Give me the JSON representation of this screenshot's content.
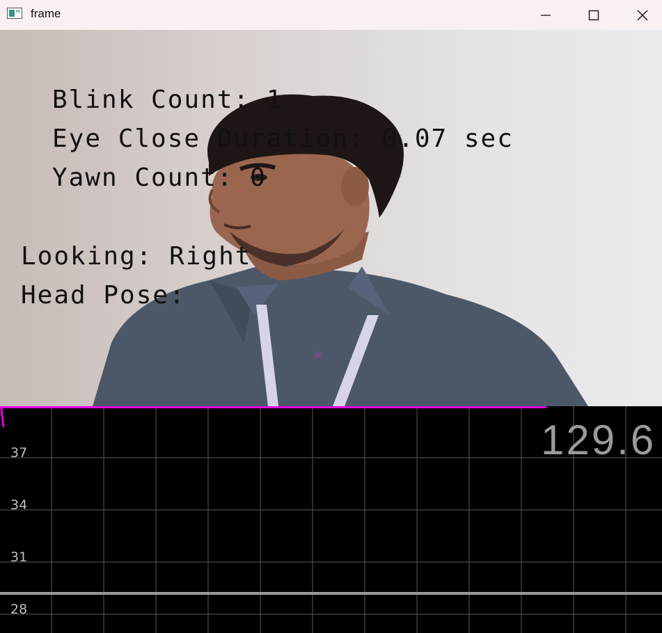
{
  "window": {
    "title": "frame"
  },
  "overlay": {
    "blink_count": "Blink Count: 1",
    "eye_close_duration": "Eye Close Duration: 0.07 sec",
    "yawn_count": "Yawn Count: 0",
    "looking": "Looking: Right",
    "head_pose": "Head Pose:"
  },
  "plot": {
    "readout": "129.6",
    "y_ticks": [
      "37",
      "34",
      "31",
      "28"
    ],
    "colors": {
      "trace": "#e600e6",
      "level": "#9a9a9a",
      "grid": "#4a4a4a"
    }
  }
}
